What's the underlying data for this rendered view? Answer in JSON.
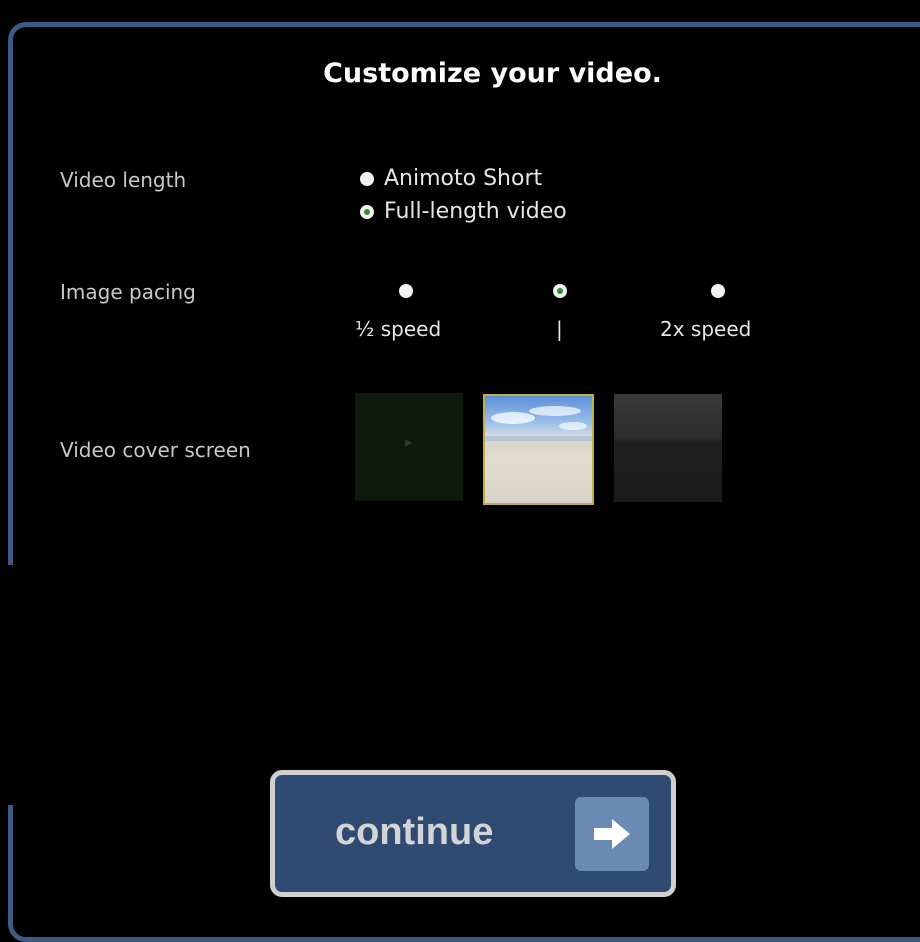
{
  "title": "Customize your video.",
  "video_length": {
    "label": "Video length",
    "options": [
      {
        "label": "Animoto Short",
        "selected": false
      },
      {
        "label": "Full-length video",
        "selected": true
      }
    ]
  },
  "image_pacing": {
    "label": "Image pacing",
    "options": [
      {
        "label": "½ speed",
        "selected": false
      },
      {
        "label": "|",
        "selected": true
      },
      {
        "label": "2x speed",
        "selected": false
      }
    ]
  },
  "cover_screen": {
    "label": "Video cover screen",
    "selected_index": 1
  },
  "continue_button": {
    "label": "continue"
  },
  "colors": {
    "frame_border": "#3c5a82",
    "button_fill": "#2f4b73",
    "selected_dot": "#2f8f2f"
  },
  "icons": [
    "play-icon",
    "arrow-right-icon"
  ]
}
